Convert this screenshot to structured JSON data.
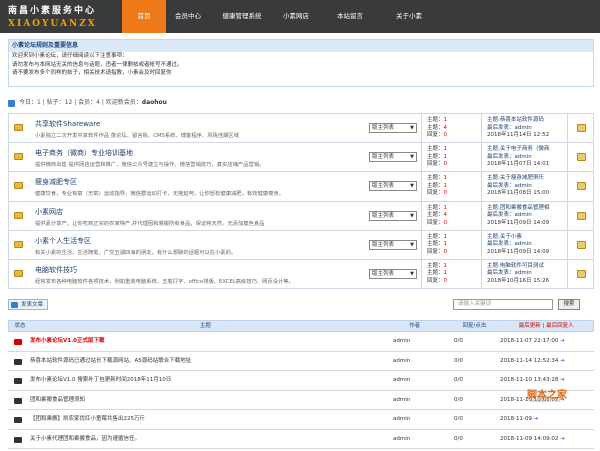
{
  "header": {
    "logo_cn": "南昌小素服务中心",
    "logo_en": "XIAOYUANZX",
    "nav": [
      {
        "label": "首页",
        "active": true,
        "width": 44
      },
      {
        "label": "会员中心",
        "active": false,
        "width": 44
      },
      {
        "label": "健康管理系统",
        "active": false,
        "width": 64
      },
      {
        "label": "小素网店",
        "active": false,
        "width": 44
      },
      {
        "label": "本站留言",
        "active": false,
        "width": 64
      },
      {
        "label": "关于小素",
        "active": false,
        "width": 54
      }
    ]
  },
  "notice": {
    "title": "小素论坛规则及重要信息",
    "lines": [
      "欢迎来到小素论坛，请仔细阅读以下注意事项：",
      "请勿发布与本网站无关的信息与话题，违者一律删帖或者帐号不通过。",
      "请不要发布多个同样的帖子，相关技术请指教，小素会及时回复你"
    ]
  },
  "stats": {
    "text": "今日：1 | 帖子：12 | 会员：4 | 欢迎新会员：",
    "new_member": "daohou"
  },
  "forums": [
    {
      "name": "共享软件Shareware",
      "desc": "小素独立二次开发共享软件作品 像论坛、留言板、CMS系统、博客程序、风情佳期区域",
      "moderator": "版主列表",
      "theme": "主题：",
      "theme_val": "1",
      "post": "主题：",
      "post_val": "4",
      "reply": "回复：",
      "reply_val": "0",
      "last_title": "主题:恭喜本站软件源码",
      "last_author": "最后发表：admin",
      "last_time": "2018年11月14日 12:52"
    },
    {
      "name": "电子商务（微商）专业培训基地",
      "desc": "提供微商出售 提供网店运营和推广、微信公众号建立与操作、微信营销技巧，真实店铺产品营销。",
      "moderator": "版主列表",
      "theme": "主题：",
      "theme_val": "1",
      "post": "主题：",
      "post_val": "1",
      "reply": "回复：",
      "reply_val": "0",
      "last_title": "主题:关于电子商务（微商",
      "last_author": "最后发表：admin",
      "last_time": "2018年11月07日 14:01"
    },
    {
      "name": "瘦身减肥专区",
      "desc": "健康饮食，专业有氧（无氧）运动指导，微信群运动打卡，无拖延呵，让你轻松健康减肥，有效健康瘦身。",
      "moderator": "版主列表",
      "theme": "主题：",
      "theme_val": "1",
      "post": "主题：",
      "post_val": "1",
      "reply": "回复：",
      "reply_val": "0",
      "last_title": "主题:关于瘦身减肥俱乐",
      "last_author": "最后发表：admin",
      "last_time": "2018年11月08日 15:00"
    },
    {
      "name": "小素网店",
      "desc": "提供素分享产，让你吃到正宗的农家特产,并代理团和乘搬所有食品，保证纯天然、无添加健色食品",
      "moderator": "版主列表",
      "theme": "主题：",
      "theme_val": "1",
      "post": "主题：",
      "post_val": "4",
      "reply": "回复：",
      "reply_val": "0",
      "last_title": "主题:团和乘搬食品管理相",
      "last_author": "最后发表：admin",
      "last_time": "2018年11月09日 14:09"
    },
    {
      "name": "小素个人生活专区",
      "desc": "有关小素的生活，生活随笔，广交五湖四海的朋友，有什么想聊的话题可以在小素的。",
      "moderator": "版主列表",
      "theme": "主题：",
      "theme_val": "1",
      "post": "主题：",
      "post_val": "1",
      "reply": "回复：",
      "reply_val": "0",
      "last_title": "主题:关于小素",
      "last_author": "最后发表：admin",
      "last_time": "2018年11月09日 14:09"
    },
    {
      "name": "电脑软件技巧",
      "desc": "经常发布各种电脑软件各项技术，例如重装电脑系统、五笔打字、office排版、EXCEL高级技巧、网页设计等。",
      "moderator": "版主列表",
      "theme": "主题：",
      "theme_val": "1",
      "post": "主题：",
      "post_val": "1",
      "reply": "回复：",
      "reply_val": "0",
      "last_title": "主题:电脑软件可目测试",
      "last_author": "最后发表：admin",
      "last_time": "2018年10月16日 15:26"
    }
  ],
  "toolbar": {
    "new_post": "发表文章",
    "search_placeholder": "请输入关键词",
    "search_button": "搜索"
  },
  "thread_header": {
    "status": "状态",
    "title": "主题",
    "author": "作者",
    "replies": "回复/点击",
    "last": "最后更新 | 最后回复人"
  },
  "threads": [
    {
      "title": "发布小素论坛V1.0正式版下载",
      "hot": true,
      "author": "admin",
      "replies": "0/0",
      "last": "2018-11-07 22:17:00"
    },
    {
      "title": "恭喜本站软件源码已通过站长下载源网站、A5源码站联合下载地址",
      "hot": false,
      "author": "admin",
      "replies": "0/0",
      "last": "2018-11-14 12:52:34"
    },
    {
      "title": "发布小素论坛V1.0 搜索补丁包更新时间2018年11月10日",
      "hot": false,
      "author": "admin",
      "replies": "0/0",
      "last": "2018-11-10 13:43:28"
    },
    {
      "title": "团和乘搬食品管理须知",
      "hot": false,
      "author": "admin",
      "replies": "0/0",
      "last": "2018-11-10 10:05:07"
    },
    {
      "title": "【团和乘搬】凯农家优红小童莓共售出225万斤",
      "hot": false,
      "author": "admin",
      "replies": "0/0",
      "last": "2018-11-09"
    },
    {
      "title": "关于小素代理团和乘搬食品，因为遵循信任。",
      "hot": false,
      "author": "admin",
      "replies": "0/0",
      "last": "2018-11-09 14:09:02"
    }
  ],
  "watermark": {
    "main": "脚本之家",
    "sub": "www.jb51.net"
  }
}
